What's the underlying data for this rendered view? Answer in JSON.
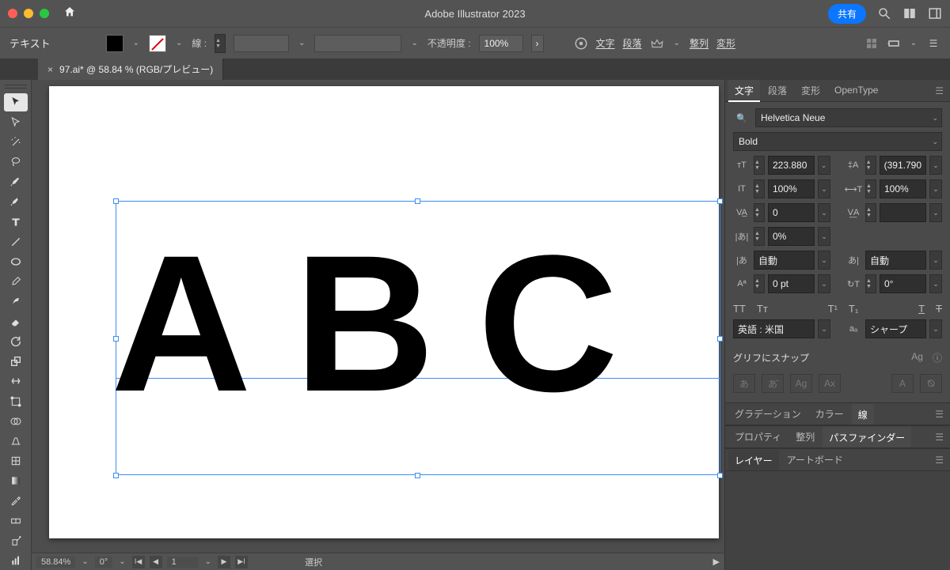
{
  "titlebar": {
    "app_name": "Adobe Illustrator 2023",
    "share": "共有"
  },
  "ctrlbar": {
    "context": "テキスト",
    "stroke_label": "線 :",
    "opacity_label": "不透明度 :",
    "opacity_value": "100%",
    "links": {
      "char": "文字",
      "para": "段落",
      "align": "整列",
      "transform": "変形"
    }
  },
  "doc_tab": {
    "name": "97.ai* @ 58.84 % (RGB/プレビュー)"
  },
  "canvas": {
    "text": "ABC"
  },
  "statusbar": {
    "zoom": "58.84%",
    "angle": "0°",
    "artboard": "1",
    "selection": "選択"
  },
  "char_panel": {
    "tabs": {
      "char": "文字",
      "para": "段落",
      "transform": "変形",
      "opentype": "OpenType"
    },
    "font_family": "Helvetica Neue",
    "font_style": "Bold",
    "size": "223.880",
    "leading": "(391.790",
    "hscale": "100%",
    "vscale": "100%",
    "kerning": "0",
    "tracking": "",
    "tsume": "0%",
    "aki_left": "自動",
    "aki_right": "自動",
    "baseline_shift": "0 pt",
    "rotation": "0°",
    "language": "英語 : 米国",
    "antialias": "シャープ",
    "snap_label": "グリフにスナップ"
  },
  "panel_group2": {
    "gradient": "グラデーション",
    "color": "カラー",
    "stroke": "線"
  },
  "panel_group3": {
    "properties": "プロパティ",
    "align": "整列",
    "pathfinder": "パスファインダー"
  },
  "panel_group4": {
    "layers": "レイヤー",
    "artboards": "アートボード"
  }
}
